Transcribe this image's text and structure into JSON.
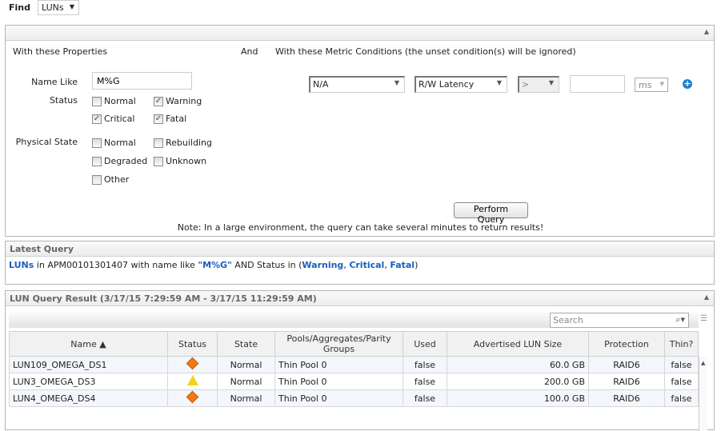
{
  "find": {
    "label": "Find",
    "value": "LUNs"
  },
  "criteria": {
    "properties_title": "With these Properties",
    "and_label": "And",
    "metric_title": "With these Metric Conditions (the unset condition(s) will be ignored)",
    "name_like_label": "Name Like",
    "name_like_value": "M%G",
    "status_label": "Status",
    "status": [
      {
        "label": "Normal",
        "checked": false
      },
      {
        "label": "Warning",
        "checked": true
      },
      {
        "label": "Critical",
        "checked": true
      },
      {
        "label": "Fatal",
        "checked": true
      }
    ],
    "physical_label": "Physical State",
    "physical": [
      {
        "label": "Normal",
        "checked": false
      },
      {
        "label": "Rebuilding",
        "checked": false
      },
      {
        "label": "Degraded",
        "checked": false
      },
      {
        "label": "Unknown",
        "checked": false
      },
      {
        "label": "Other",
        "checked": false
      }
    ],
    "metric": {
      "aggregate": "N/A",
      "metric": "R/W Latency",
      "operator": ">",
      "value": "",
      "unit": "ms"
    },
    "perform_button": "Perform Query",
    "note": "Note: In a large environment, the query can take several minutes to return results!"
  },
  "latest": {
    "title": "Latest Query",
    "t1": "LUNs",
    "t2": " in APM00101301407 with name like ",
    "t3": "\"M%G\"",
    "t4": " AND Status in (",
    "s1": "Warning",
    "s2": "Critical",
    "s3": "Fatal",
    "sep": ", ",
    "close": ")"
  },
  "result": {
    "title": "LUN Query Result (3/17/15 7:29:59 AM - 3/17/15 11:29:59 AM)",
    "search_placeholder": "Search",
    "columns": [
      "Name ▲",
      "Status",
      "State",
      "Pools/Aggregates/Parity Groups",
      "Used",
      "Advertised LUN Size",
      "Protection",
      "Thin?"
    ],
    "rows": [
      {
        "name": "LUN109_OMEGA_DS1",
        "status": "critical",
        "state": "Normal",
        "pool": "Thin Pool 0",
        "used": "false",
        "size": "60.0 GB",
        "protection": "RAID6",
        "thin": "false"
      },
      {
        "name": "LUN3_OMEGA_DS3",
        "status": "warning",
        "state": "Normal",
        "pool": "Thin Pool 0",
        "used": "false",
        "size": "200.0 GB",
        "protection": "RAID6",
        "thin": "false"
      },
      {
        "name": "LUN4_OMEGA_DS4",
        "status": "critical",
        "state": "Normal",
        "pool": "Thin Pool 0",
        "used": "false",
        "size": "100.0 GB",
        "protection": "RAID6",
        "thin": "false"
      }
    ]
  },
  "colors": {
    "link": "#1a5fc0",
    "critical": "#f07a1a",
    "warning": "#f2d31b"
  }
}
